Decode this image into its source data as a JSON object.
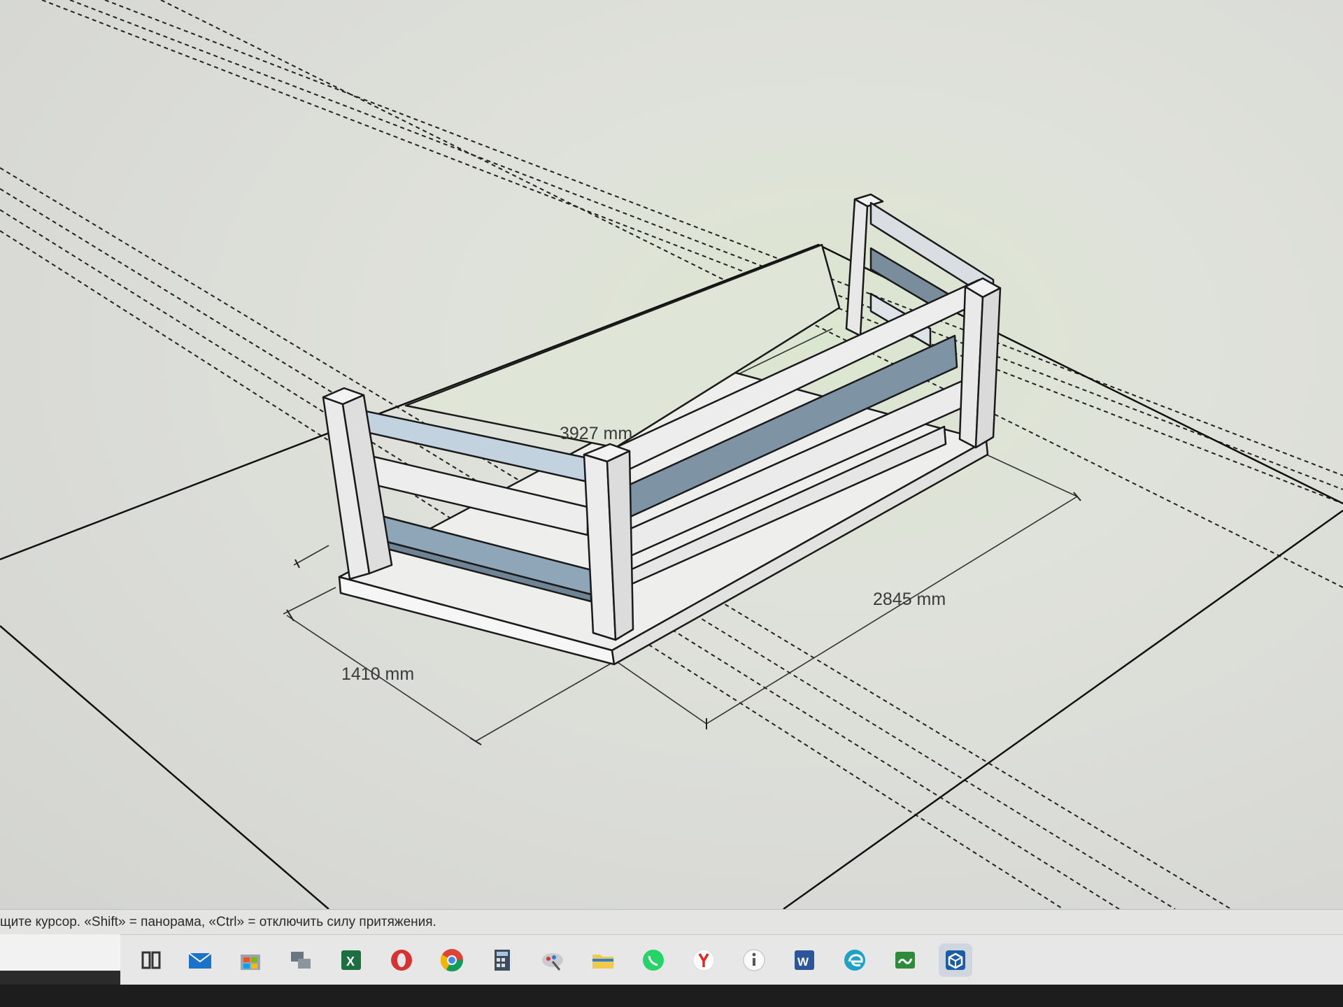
{
  "viewport": {
    "dimensions": [
      {
        "id": "depth",
        "label": "1410 mm"
      },
      {
        "id": "length",
        "label": "2845 mm"
      },
      {
        "id": "inner-length",
        "label": "3927 mm"
      }
    ]
  },
  "statusbar": {
    "text": "щите курсор. «Shift» = панорама, «Ctrl» = отключить силу притяжения."
  },
  "measurements": {
    "value": ""
  },
  "taskbar": {
    "icons": [
      {
        "name": "task-view-icon"
      },
      {
        "name": "mail-icon"
      },
      {
        "name": "store-icon"
      },
      {
        "name": "network-icon"
      },
      {
        "name": "excel-icon"
      },
      {
        "name": "opera-icon"
      },
      {
        "name": "chrome-icon"
      },
      {
        "name": "calculator-icon"
      },
      {
        "name": "paint-icon"
      },
      {
        "name": "file-explorer-icon"
      },
      {
        "name": "whatsapp-icon"
      },
      {
        "name": "yandex-icon"
      },
      {
        "name": "info-icon"
      },
      {
        "name": "word-icon"
      },
      {
        "name": "edge-icon"
      },
      {
        "name": "sketchup-layout-icon"
      },
      {
        "name": "sketchup-icon"
      }
    ]
  },
  "colors": {
    "canvas": "#d9dad6",
    "highlight": "#dbe6cf",
    "rail_light": "#c9d6e0",
    "rail_dark": "#7f95a6",
    "post": "#ededed"
  }
}
